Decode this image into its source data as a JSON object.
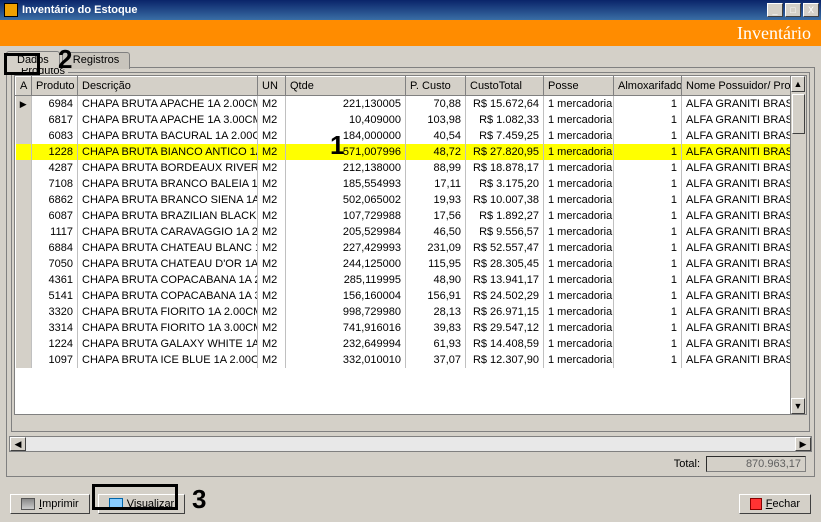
{
  "window": {
    "title": "Inventário do Estoque",
    "band_title": "Inventário"
  },
  "tabs": {
    "dados": "Dados",
    "registros": "Registros"
  },
  "group_label": "Produtos",
  "columns": {
    "produto": "Produto",
    "descricao": "Descrição",
    "un": "UN",
    "qtde": "Qtde",
    "pcusto": "P. Custo",
    "custototal": "CustoTotal",
    "posse": "Posse",
    "almox": "Almoxarifado",
    "nome": "Nome Possuidor/ Proprietá"
  },
  "rows": [
    {
      "produto": "6984",
      "desc": "CHAPA BRUTA APACHE 1A 2.00CM",
      "un": "M2",
      "qtde": "221,130005",
      "pc": "70,88",
      "ct": "R$ 15.672,64",
      "posse": "1 mercadoria",
      "alm": "1",
      "nome": "ALFA GRANITI BRASIL LT"
    },
    {
      "produto": "6817",
      "desc": "CHAPA BRUTA APACHE 1A 3.00CM",
      "un": "M2",
      "qtde": "10,409000",
      "pc": "103,98",
      "ct": "R$ 1.082,33",
      "posse": "1 mercadoria",
      "alm": "1",
      "nome": "ALFA GRANITI BRASIL LT"
    },
    {
      "produto": "6083",
      "desc": "CHAPA BRUTA BACURAL 1A 2.00C",
      "un": "M2",
      "qtde": "184,000000",
      "pc": "40,54",
      "ct": "R$ 7.459,25",
      "posse": "1 mercadoria",
      "alm": "1",
      "nome": "ALFA GRANITI BRASIL LT"
    },
    {
      "produto": "1228",
      "desc": "CHAPA BRUTA BIANCO ANTICO 1A",
      "un": "M2",
      "qtde": "571,007996",
      "pc": "48,72",
      "ct": "R$ 27.820,95",
      "posse": "1 mercadoria",
      "alm": "1",
      "nome": "ALFA GRANITI BRASIL LT",
      "selected": true
    },
    {
      "produto": "4287",
      "desc": "CHAPA BRUTA BORDEAUX RIVER",
      "un": "M2",
      "qtde": "212,138000",
      "pc": "88,99",
      "ct": "R$ 18.878,17",
      "posse": "1 mercadoria",
      "alm": "1",
      "nome": "ALFA GRANITI BRASIL LT"
    },
    {
      "produto": "7108",
      "desc": "CHAPA BRUTA BRANCO BALEIA 1A",
      "un": "M2",
      "qtde": "185,554993",
      "pc": "17,11",
      "ct": "R$ 3.175,20",
      "posse": "1 mercadoria",
      "alm": "1",
      "nome": "ALFA GRANITI BRASIL LT"
    },
    {
      "produto": "6862",
      "desc": "CHAPA BRUTA BRANCO SIENA 1A",
      "un": "M2",
      "qtde": "502,065002",
      "pc": "19,93",
      "ct": "R$ 10.007,38",
      "posse": "1 mercadoria",
      "alm": "1",
      "nome": "ALFA GRANITI BRASIL LT"
    },
    {
      "produto": "6087",
      "desc": "CHAPA BRUTA BRAZILIAN BLACK",
      "un": "M2",
      "qtde": "107,729988",
      "pc": "17,56",
      "ct": "R$ 1.892,27",
      "posse": "1 mercadoria",
      "alm": "1",
      "nome": "ALFA GRANITI BRASIL LT"
    },
    {
      "produto": "1117",
      "desc": "CHAPA BRUTA CARAVAGGIO 1A 2.",
      "un": "M2",
      "qtde": "205,529984",
      "pc": "46,50",
      "ct": "R$ 9.556,57",
      "posse": "1 mercadoria",
      "alm": "1",
      "nome": "ALFA GRANITI BRASIL LT"
    },
    {
      "produto": "6884",
      "desc": "CHAPA BRUTA CHATEAU BLANC 1",
      "un": "M2",
      "qtde": "227,429993",
      "pc": "231,09",
      "ct": "R$ 52.557,47",
      "posse": "1 mercadoria",
      "alm": "1",
      "nome": "ALFA GRANITI BRASIL LT"
    },
    {
      "produto": "7050",
      "desc": "CHAPA BRUTA CHATEAU D'OR 1A",
      "un": "M2",
      "qtde": "244,125000",
      "pc": "115,95",
      "ct": "R$ 28.305,45",
      "posse": "1 mercadoria",
      "alm": "1",
      "nome": "ALFA GRANITI BRASIL LT"
    },
    {
      "produto": "4361",
      "desc": "CHAPA BRUTA COPACABANA 1A 2",
      "un": "M2",
      "qtde": "285,119995",
      "pc": "48,90",
      "ct": "R$ 13.941,17",
      "posse": "1 mercadoria",
      "alm": "1",
      "nome": "ALFA GRANITI BRASIL LT"
    },
    {
      "produto": "5141",
      "desc": "CHAPA BRUTA COPACABANA 1A 3",
      "un": "M2",
      "qtde": "156,160004",
      "pc": "156,91",
      "ct": "R$ 24.502,29",
      "posse": "1 mercadoria",
      "alm": "1",
      "nome": "ALFA GRANITI BRASIL LT"
    },
    {
      "produto": "3320",
      "desc": "CHAPA BRUTA FIORITO 1A 2.00CM",
      "un": "M2",
      "qtde": "998,729980",
      "pc": "28,13",
      "ct": "R$ 26.971,15",
      "posse": "1 mercadoria",
      "alm": "1",
      "nome": "ALFA GRANITI BRASIL LT"
    },
    {
      "produto": "3314",
      "desc": "CHAPA BRUTA FIORITO 1A 3.00CM",
      "un": "M2",
      "qtde": "741,916016",
      "pc": "39,83",
      "ct": "R$ 29.547,12",
      "posse": "1 mercadoria",
      "alm": "1",
      "nome": "ALFA GRANITI BRASIL LT"
    },
    {
      "produto": "1224",
      "desc": "CHAPA BRUTA GALAXY WHITE 1A",
      "un": "M2",
      "qtde": "232,649994",
      "pc": "61,93",
      "ct": "R$ 14.408,59",
      "posse": "1 mercadoria",
      "alm": "1",
      "nome": "ALFA GRANITI BRASIL LT"
    },
    {
      "produto": "1097",
      "desc": "CHAPA BRUTA ICE BLUE 1A 2.00CM",
      "un": "M2",
      "qtde": "332,010010",
      "pc": "37,07",
      "ct": "R$ 12.307,90",
      "posse": "1 mercadoria",
      "alm": "1",
      "nome": "ALFA GRANITI BRASIL LT"
    }
  ],
  "footer": {
    "total_label": "Total:",
    "total_value": "870.963,17",
    "imprimir": "Imprimir",
    "visualizar": "Visualizar",
    "fechar": "Fechar"
  },
  "annotations": {
    "n1": "1",
    "n2": "2",
    "n3": "3"
  },
  "winbtns": {
    "min": "_",
    "max": "□",
    "close": "X"
  }
}
